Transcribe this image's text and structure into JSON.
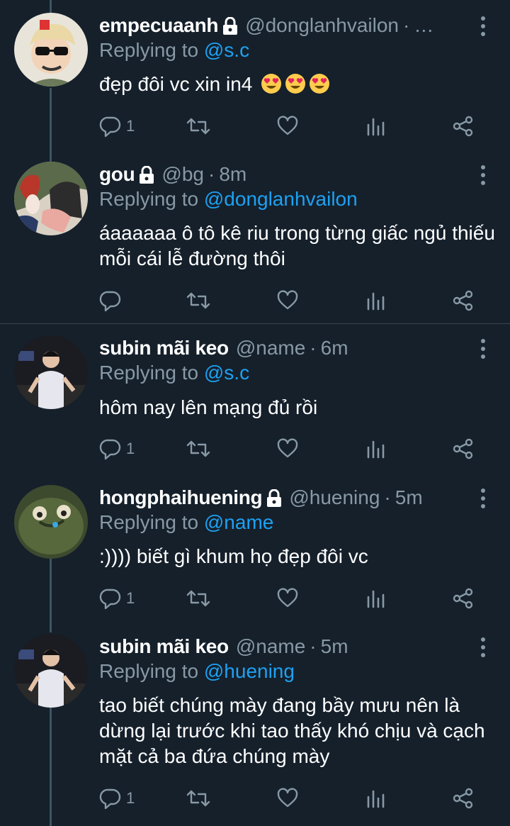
{
  "tweets": [
    {
      "name": "empecuaanh",
      "locked": true,
      "handle": "@donglanhvailon",
      "sep": "·",
      "time": "…",
      "reply_prefix": "Replying to",
      "reply_to": "@s.c",
      "text": "đẹp đôi vc xin in4",
      "emojis": [
        "heart-eyes-emoji",
        "heart-eyes-emoji",
        "heart-eyes-emoji"
      ],
      "reply_count": "1",
      "avatar_icon": "user-avatar"
    },
    {
      "name": "gou",
      "locked": true,
      "handle": "@bg",
      "sep": "·",
      "time": "8m",
      "reply_prefix": "Replying to",
      "reply_to": "@donglanhvailon",
      "text": "áaaaaaa ô tô kê riu trong từng giấc ngủ thiếu mỗi cái lễ đường thôi",
      "reply_count": "",
      "avatar_icon": "user-avatar"
    },
    {
      "name": "subin mãi keo",
      "locked": false,
      "handle": "@name",
      "sep": "·",
      "time": "6m",
      "reply_prefix": "Replying to",
      "reply_to": "@s.c",
      "text": "hôm nay lên mạng đủ rồi",
      "reply_count": "1",
      "avatar_icon": "user-avatar"
    },
    {
      "name": "hongphaihuening",
      "locked": true,
      "handle": "@huening",
      "sep": "·",
      "time": "5m",
      "reply_prefix": "Replying to",
      "reply_to": "@name",
      "text": ":)))) biết gì khum họ đẹp đôi vc",
      "reply_count": "1",
      "avatar_icon": "user-avatar"
    },
    {
      "name": "subin mãi keo",
      "locked": false,
      "handle": "@name",
      "sep": "·",
      "time": "5m",
      "reply_prefix": "Replying to",
      "reply_to": "@huening",
      "text": "tao biết chúng mày đang bầy mưu nên là dừng lại trước khi tao thấy khó chịu và cạch mặt cả ba đứa chúng mày",
      "reply_count": "1",
      "avatar_icon": "user-avatar"
    }
  ],
  "colors": {
    "background": "#15202b",
    "text": "#ffffff",
    "muted": "#8899a6",
    "link": "#1da1f2",
    "divider": "#38444d",
    "thread_line": "#3d5466"
  },
  "icons": {
    "reply": "reply-icon",
    "retweet": "retweet-icon",
    "like": "heart-icon",
    "analytics": "analytics-icon",
    "share": "share-icon",
    "more": "more-vertical-icon",
    "lock": "lock-icon"
  }
}
